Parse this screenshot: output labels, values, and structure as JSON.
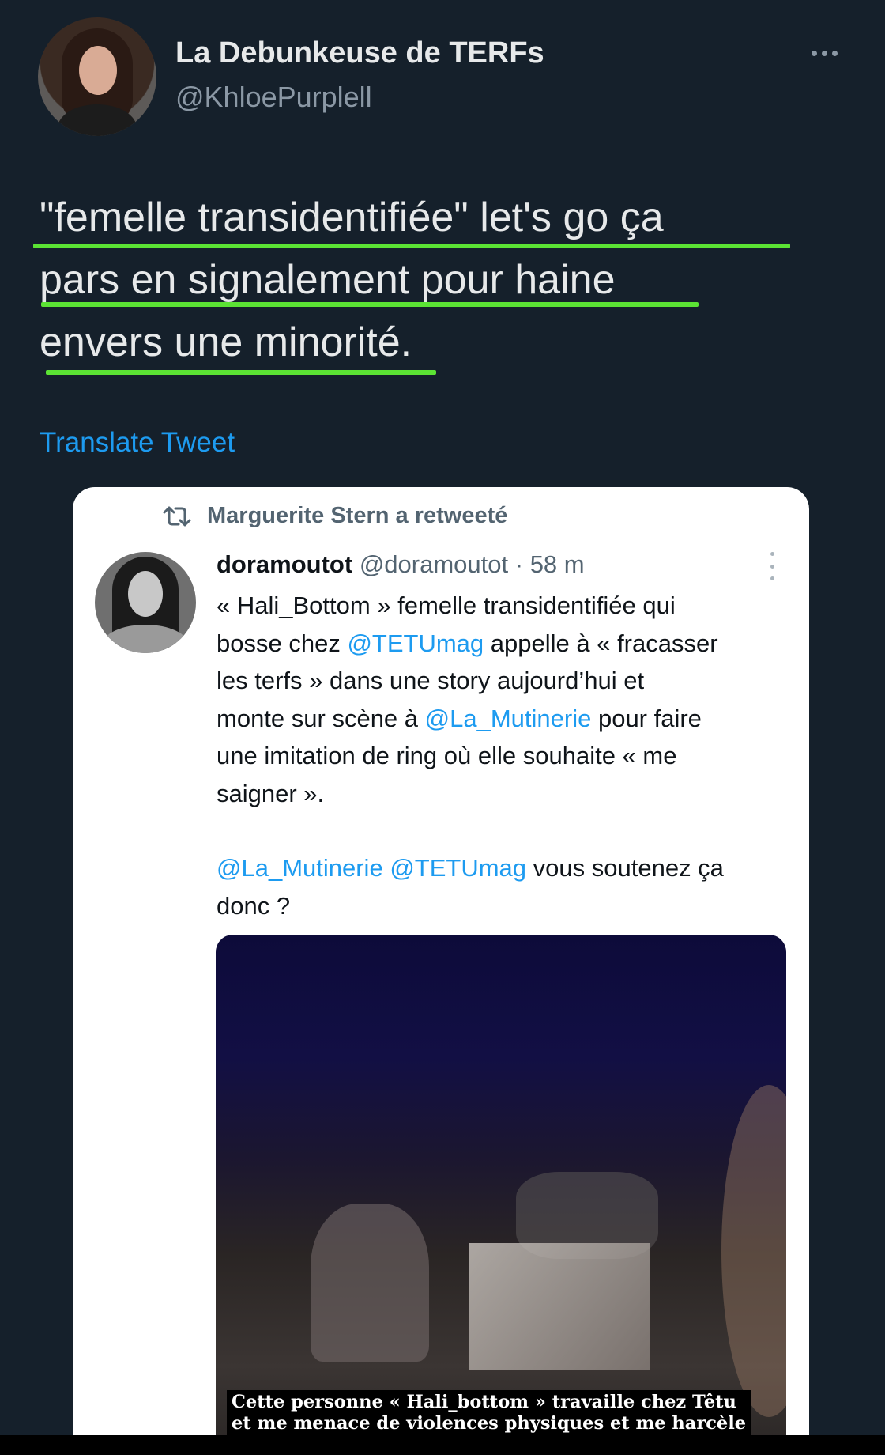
{
  "tweet": {
    "author_name": "La Debunkeuse de TERFs",
    "author_handle": "@KhloePurplell",
    "text_lines": [
      "\"femelle transidentifiée\" let's go ça",
      "pars en signalement pour haine",
      "envers une minorité."
    ],
    "highlight_color": "#5be334",
    "translate_label": "Translate Tweet"
  },
  "quoted": {
    "retweet_label": "Marguerite Stern a retweeté",
    "author_name": "doramoutot",
    "author_handle": "@doramoutot",
    "separator": " · ",
    "time": "58 m",
    "body": {
      "l1": "« Hali_Bottom » femelle transidentifiée qui",
      "l2_pre": "bosse chez ",
      "l2_mention": "@TETUmag",
      "l2_post": " appelle à « fracasser",
      "l3": "les terfs » dans une story aujourd’hui et",
      "l4_pre": "monte sur scène à ",
      "l4_mention": "@La_Mutinerie",
      "l4_post": " pour faire",
      "l5": "une imitation de ring où elle souhaite « me",
      "l6": "saigner ».",
      "l7_mention1": "@La_Mutinerie",
      "l7_space": " ",
      "l7_mention2": "@TETUmag",
      "l7_post": " vous soutenez ça",
      "l8": "donc ?"
    },
    "caption_line1": "Cette personne « Hali_bottom » travaille chez Têtu",
    "caption_line2": "et me menace de violences physiques et me harcèle"
  },
  "colors": {
    "background": "#15202b",
    "link": "#1d9bf0",
    "text_primary": "#e7e9ea",
    "text_secondary": "#8b98a5"
  }
}
